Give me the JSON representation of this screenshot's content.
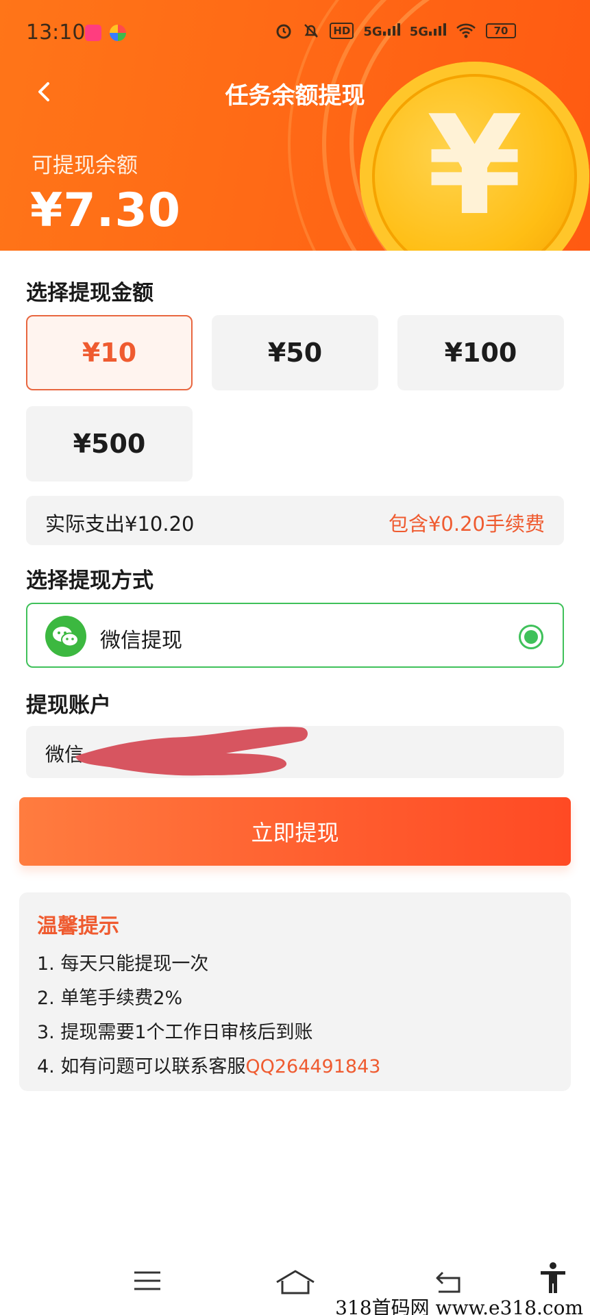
{
  "status_bar": {
    "time": "13:10",
    "hd_label": "HD",
    "signal1": "5G",
    "signal2": "5G",
    "battery": "70"
  },
  "header": {
    "title": "任务余额提现",
    "balance_label": "可提现余额",
    "balance_value": "¥7.30",
    "coin_symbol": "¥"
  },
  "amount_section": {
    "title": "选择提现金额",
    "options": [
      "¥10",
      "¥50",
      "¥100",
      "¥500"
    ],
    "selected_index": 0
  },
  "fee": {
    "actual_label": "实际支出¥10.20",
    "fee_note": "包含¥0.20手续费"
  },
  "method_section": {
    "title": "选择提现方式",
    "option_label": "微信提现"
  },
  "account_section": {
    "title": "提现账户",
    "value_visible": "微信"
  },
  "submit_label": "立即提现",
  "tips": {
    "title": "温馨提示",
    "items": [
      "1. 每天只能提现一次",
      "2. 单笔手续费2%",
      "3. 提现需要1个工作日审核后到账"
    ],
    "item4_prefix": "4. 如有问题可以联系客服",
    "item4_qq": "QQ264491843"
  },
  "watermark": "318首码网 www.e318.com",
  "colors": {
    "header_orange": "#ff6a16",
    "accent": "#ef5b30",
    "wechat_green": "#3fc15a"
  }
}
